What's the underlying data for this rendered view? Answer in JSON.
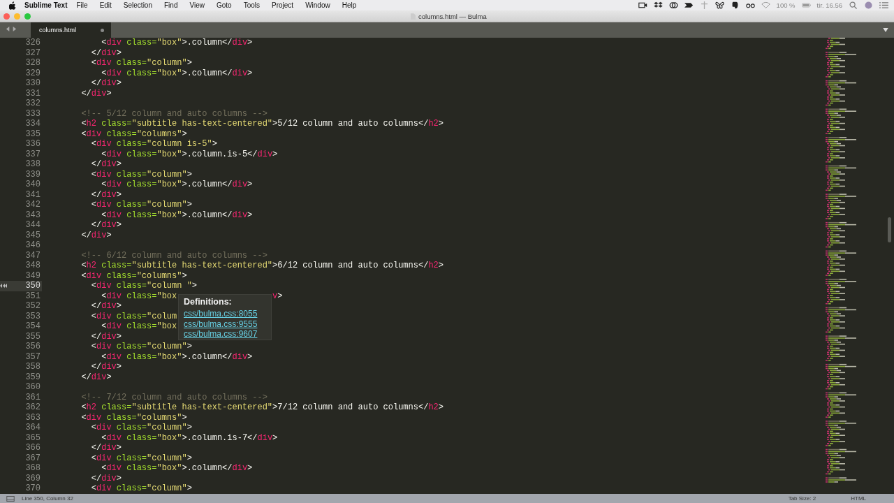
{
  "menu_bar": {
    "app": "Sublime Text",
    "items": [
      "File",
      "Edit",
      "Selection",
      "Find",
      "View",
      "Goto",
      "Tools",
      "Project",
      "Window",
      "Help"
    ],
    "battery": "100 %",
    "clock": "tir. 16.56"
  },
  "window": {
    "title": "columns.html — Bulma"
  },
  "tabs": [
    {
      "label": "columns.html",
      "selected": true,
      "modified": true
    }
  ],
  "lines": [
    {
      "number": "326",
      "code": "      <div class=\"box\">.column</div>",
      "current": false
    },
    {
      "number": "327",
      "code": "    </div>",
      "current": false
    },
    {
      "number": "328",
      "code": "    <div class=\"column\">",
      "current": false
    },
    {
      "number": "329",
      "code": "      <div class=\"box\">.column</div>",
      "current": false
    },
    {
      "number": "330",
      "code": "    </div>",
      "current": false
    },
    {
      "number": "331",
      "code": "  </div>",
      "current": false
    },
    {
      "number": "332",
      "current": false
    },
    {
      "number": "333",
      "code": "  <!-- 5/12 column and auto columns -->",
      "current": false
    },
    {
      "number": "334",
      "code": "  <h2 class=\"subtitle has-text-centered\">5/12 column and auto columns</h2>",
      "current": false
    },
    {
      "number": "335",
      "code": "  <div class=\"columns\">",
      "current": false
    },
    {
      "number": "336",
      "code": "    <div class=\"column is-5\">",
      "current": false
    },
    {
      "number": "337",
      "code": "      <div class=\"box\">.column.is-5</div>",
      "current": false
    },
    {
      "number": "338",
      "code": "    </div>",
      "current": false
    },
    {
      "number": "339",
      "code": "    <div class=\"column\">",
      "current": false
    },
    {
      "number": "340",
      "code": "      <div class=\"box\">.column</div>",
      "current": false
    },
    {
      "number": "341",
      "code": "    </div>",
      "current": false
    },
    {
      "number": "342",
      "code": "    <div class=\"column\">",
      "current": false
    },
    {
      "number": "343",
      "code": "      <div class=\"box\">.column</div>",
      "current": false
    },
    {
      "number": "344",
      "code": "    </div>",
      "current": false
    },
    {
      "number": "345",
      "code": "  </div>",
      "current": false
    },
    {
      "number": "346",
      "current": false
    },
    {
      "number": "347",
      "code": "  <!-- 6/12 column and auto columns -->",
      "current": false
    },
    {
      "number": "348",
      "code": "  <h2 class=\"subtitle has-text-centered\">6/12 column and auto columns</h2>",
      "current": false
    },
    {
      "number": "349",
      "code": "  <div class=\"columns\">",
      "current": false
    },
    {
      "number": "350",
      "code": "    <div class=\"column \">",
      "current": true
    },
    {
      "number": "351",
      "code": "      <div class=\"box",
      "tail": "v>",
      "current": false
    },
    {
      "number": "352",
      "code": "    </div>",
      "current": false
    },
    {
      "number": "353",
      "code": "    <div class=\"colum",
      "current": false
    },
    {
      "number": "354",
      "code": "      <div class=\"box",
      "current": false
    },
    {
      "number": "355",
      "code": "    </div>",
      "current": false
    },
    {
      "number": "356",
      "code": "    <div class=\"column\">",
      "current": false
    },
    {
      "number": "357",
      "code": "      <div class=\"box\">.column</div>",
      "current": false
    },
    {
      "number": "358",
      "code": "    </div>",
      "current": false
    },
    {
      "number": "359",
      "code": "  </div>",
      "current": false
    },
    {
      "number": "360",
      "current": false
    },
    {
      "number": "361",
      "code": "  <!-- 7/12 column and auto columns -->",
      "current": false
    },
    {
      "number": "362",
      "code": "  <h2 class=\"subtitle has-text-centered\">7/12 column and auto columns</h2>",
      "current": false
    },
    {
      "number": "363",
      "code": "  <div class=\"columns\">",
      "current": false
    },
    {
      "number": "364",
      "code": "    <div class=\"column\">",
      "current": false
    },
    {
      "number": "365",
      "code": "      <div class=\"box\">.column.is-7</div>",
      "current": false
    },
    {
      "number": "366",
      "code": "    </div>",
      "current": false
    },
    {
      "number": "367",
      "code": "    <div class=\"column\">",
      "current": false
    },
    {
      "number": "368",
      "code": "      <div class=\"box\">.column</div>",
      "current": false
    },
    {
      "number": "369",
      "code": "    </div>",
      "current": false
    },
    {
      "number": "370",
      "code": "    <div class=\"column\">",
      "current": false
    }
  ],
  "popup": {
    "title": "Definitions:",
    "links": [
      "css/bulma.css:8055",
      "css/bulma.css:9555",
      "css/bulma.css:9607"
    ]
  },
  "status_bar": {
    "position": "Line 350, Column 32",
    "tab_size": "Tab Size: 2",
    "syntax": "HTML"
  }
}
